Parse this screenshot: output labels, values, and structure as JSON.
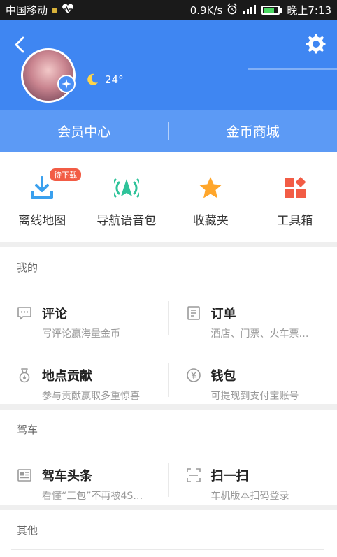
{
  "status_bar": {
    "carrier": "中国移动",
    "speed": "0.9K/s",
    "battery": "73",
    "time": "晚上7:13"
  },
  "header": {
    "temperature": "24°"
  },
  "member_bar": {
    "left": "会员中心",
    "right": "金币商城"
  },
  "quick_actions": [
    {
      "label": "离线地图",
      "badge": "待下载",
      "icon": "download-icon"
    },
    {
      "label": "导航语音包",
      "icon": "voice-nav-icon"
    },
    {
      "label": "收藏夹",
      "icon": "star-icon"
    },
    {
      "label": "工具箱",
      "icon": "toolbox-icon"
    }
  ],
  "sections": {
    "mine": {
      "title": "我的",
      "items": [
        {
          "title": "评论",
          "subtitle": "写评论赢海量金币",
          "icon": "comment-icon"
        },
        {
          "title": "订单",
          "subtitle": "酒店、门票、火车票…",
          "icon": "order-icon"
        },
        {
          "title": "地点贡献",
          "subtitle": "参与贡献赢取多重惊喜",
          "icon": "medal-icon"
        },
        {
          "title": "钱包",
          "subtitle": "可提现到支付宝账号",
          "icon": "wallet-icon"
        }
      ]
    },
    "drive": {
      "title": "驾车",
      "items": [
        {
          "title": "驾车头条",
          "subtitle": "看懂“三包”不再被4S…",
          "icon": "news-icon"
        },
        {
          "title": "扫一扫",
          "subtitle": "车机版本扫码登录",
          "icon": "scan-icon"
        }
      ]
    },
    "other": {
      "title": "其他"
    }
  },
  "colors": {
    "header_blue": "#3f86f2",
    "member_blue": "#5c9af5",
    "badge_red": "#f25c45"
  }
}
